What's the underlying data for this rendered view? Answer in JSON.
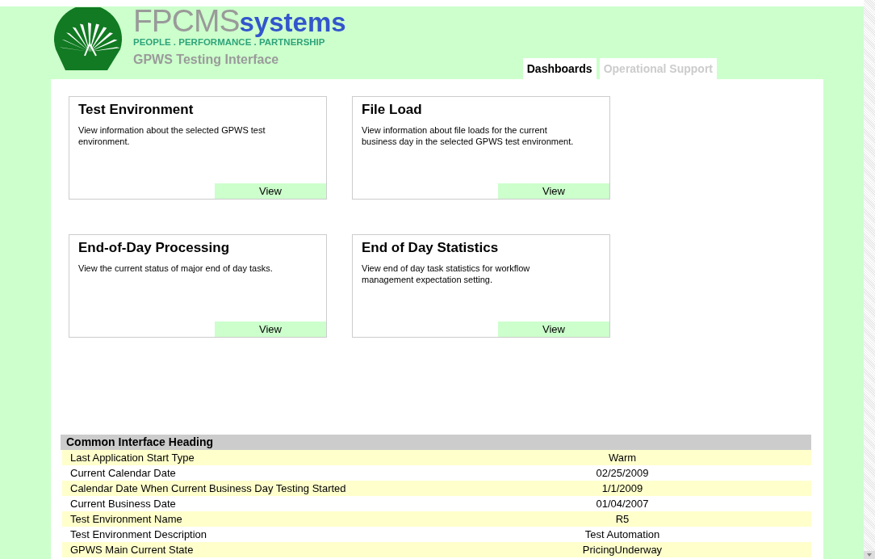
{
  "brand": {
    "name": "FPCMS",
    "suffix": "systems",
    "tagline": "PEOPLE . PERFORMANCE . PARTNERSHIP",
    "subtitle": "GPWS Testing Interface"
  },
  "tabs": [
    {
      "label": "Dashboards",
      "selected": true
    },
    {
      "label": "Operational Support",
      "selected": false
    }
  ],
  "cards": [
    {
      "title": "Test Environment",
      "description": "View information about the selected GPWS test environment.",
      "button": "View"
    },
    {
      "title": "File Load",
      "description": "View information about file loads for the current business day in the selected GPWS test environment.",
      "button": "View"
    },
    {
      "title": "End-of-Day Processing",
      "description": "View the current status of major end of day tasks.",
      "button": "View"
    },
    {
      "title": "End of Day Statistics",
      "description": "View end of day task statistics for workflow management expectation setting.",
      "button": "View"
    }
  ],
  "table": {
    "heading": "Common Interface Heading",
    "rows": [
      {
        "label": "Last Application Start Type",
        "value": "Warm"
      },
      {
        "label": "Current Calendar Date",
        "value": "02/25/2009"
      },
      {
        "label": "Calendar Date When Current Business Day Testing Started",
        "value": "1/1/2009"
      },
      {
        "label": "Current Business Date",
        "value": "01/04/2007"
      },
      {
        "label": "Test Environment Name",
        "value": "R5"
      },
      {
        "label": "Test Environment Description",
        "value": "Test Automation"
      },
      {
        "label": "GPWS Main Current State",
        "value": "PricingUnderway"
      }
    ]
  }
}
